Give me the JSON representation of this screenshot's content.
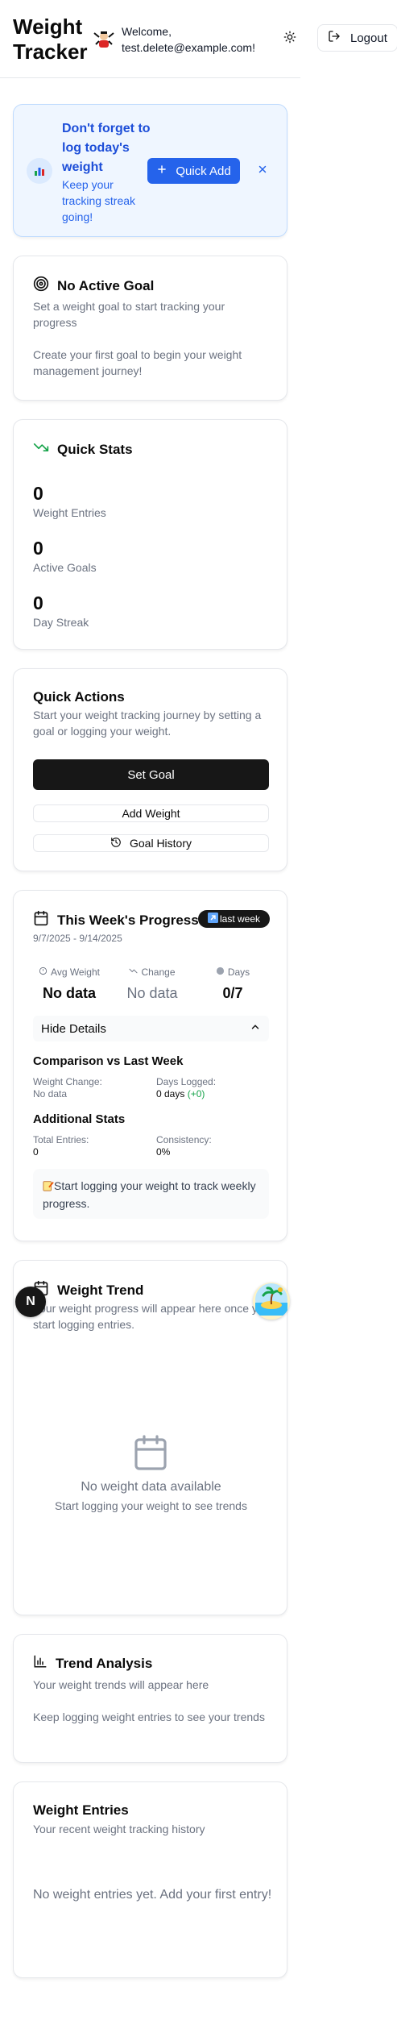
{
  "header": {
    "brand": "Weight Tracker",
    "welcome": "Welcome, test.delete@example.com!",
    "logout_label": "Logout"
  },
  "reminder": {
    "title": "Don't forget to log today's weight",
    "subtitle": "Keep your tracking streak going!",
    "quick_add_label": "Quick Add"
  },
  "no_goal": {
    "title": "No Active Goal",
    "description": "Set a weight goal to start tracking your progress",
    "cta_text": "Create your first goal to begin your weight management journey!"
  },
  "quick_stats": {
    "title": "Quick Stats",
    "items": [
      {
        "value": "0",
        "label": "Weight Entries"
      },
      {
        "value": "0",
        "label": "Active Goals"
      },
      {
        "value": "0",
        "label": "Day Streak"
      }
    ]
  },
  "quick_actions": {
    "title": "Quick Actions",
    "description": "Start your weight tracking journey by setting a goal or logging your weight.",
    "set_goal": "Set Goal",
    "add_weight": "Add Weight",
    "goal_history": "Goal History"
  },
  "weekly": {
    "title": "This Week's Progress",
    "badge": "last week",
    "date_range": "9/7/2025 - 9/14/2025",
    "columns": [
      {
        "label": "Avg Weight",
        "value": "No data"
      },
      {
        "label": "Change",
        "value": "No data"
      },
      {
        "label": "Days",
        "value": "0/7"
      }
    ],
    "toggle_label": "Hide Details",
    "comparison_title": "Comparison vs Last Week",
    "weight_change_label": "Weight Change:",
    "weight_change_value": "No data",
    "days_logged_label": "Days Logged:",
    "days_logged_value": "0 days",
    "days_logged_delta": "(+0)",
    "additional_title": "Additional Stats",
    "total_entries_label": "Total Entries:",
    "total_entries_value": "0",
    "consistency_label": "Consistency:",
    "consistency_value": "0%",
    "tip": "Start logging your weight to track weekly progress."
  },
  "trend": {
    "title": "Weight Trend",
    "description": "Your weight progress will appear here once you start logging entries.",
    "empty_title": "No weight data available",
    "empty_sub": "Start logging your weight to see trends"
  },
  "analysis": {
    "title": "Trend Analysis",
    "description": "Your weight trends will appear here",
    "empty": "Keep logging weight entries to see your trends"
  },
  "entries": {
    "title": "Weight Entries",
    "description": "Your recent weight tracking history",
    "empty": "No weight entries yet. Add your first entry!"
  },
  "floating": {
    "n_label": "N"
  },
  "colors": {
    "accent_blue": "#2563eb",
    "dark_button": "#171717",
    "positive_green": "#16a34a"
  }
}
